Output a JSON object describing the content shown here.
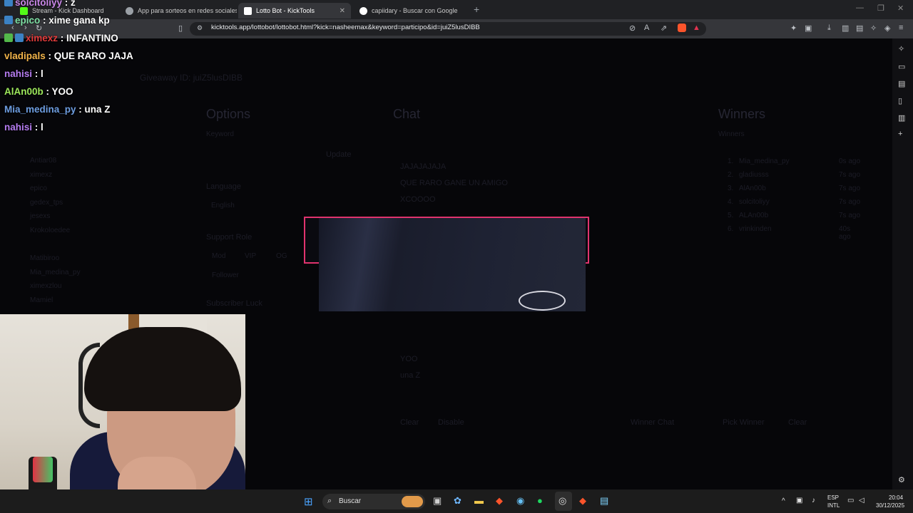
{
  "browser": {
    "tabs": [
      {
        "label": "Stream - Kick Dashboard"
      },
      {
        "label": "App para sorteos en redes sociales"
      },
      {
        "label": "Lotto Bot - KickTools"
      },
      {
        "label": "capiidary - Buscar con Google"
      }
    ],
    "url": "kicktools.app/lottobot/lottobot.html?kick=nasheemax&keyword=participo&id=juiZ5lusDIBB"
  },
  "chat_overlay": [
    {
      "user": "solcitoliyy",
      "message": "z",
      "color": "#c987e8"
    },
    {
      "user": "epico",
      "message": "xime gana kp",
      "color": "#7ee0a4"
    },
    {
      "user": "ximexz",
      "message": "INFANTINO",
      "color": "#e23b3b"
    },
    {
      "user": "vladipals",
      "message": "QUE RARO JAJA",
      "color": "#f2b44a"
    },
    {
      "user": "nahisi",
      "message": "l",
      "color": "#b57cf0"
    },
    {
      "user": "AlAn00b",
      "message": "YOO",
      "color": "#9de85b"
    },
    {
      "user": "Mia_medina_py",
      "message": "una Z",
      "color": "#6d9de0"
    },
    {
      "user": "nahisi",
      "message": "l",
      "color": "#b57cf0"
    }
  ],
  "page": {
    "giveaway_id": "Giveaway ID: juiZ5lusDIBB",
    "options": {
      "title": "Options",
      "keyword_label": "Keyword",
      "update_label": "Update",
      "language_label": "Language",
      "language_value": "English",
      "support_role_label": "Support Role",
      "roles": [
        "Mod",
        "VIP",
        "OG",
        "Follower"
      ],
      "subscriber_luck_label": "Subscriber Luck"
    },
    "chat": {
      "title": "Chat",
      "lines": [
        "JAJAJAJAJA",
        "QUE RARO GANE UN AMIGO",
        "XCOOOO",
        "YOO",
        "una Z"
      ],
      "buttons": [
        "Clear",
        "Disable",
        "Winner Chat"
      ]
    },
    "winners": {
      "title": "Winners",
      "subtitle": "Winners",
      "list": [
        {
          "rank": "1.",
          "name": "Mia_medina_py",
          "time": "0s ago"
        },
        {
          "rank": "2.",
          "name": "gladiusss",
          "time": "7s ago"
        },
        {
          "rank": "3.",
          "name": "AlAn00b",
          "time": "7s ago"
        },
        {
          "rank": "4.",
          "name": "solcitoliyy",
          "time": "7s ago"
        },
        {
          "rank": "5.",
          "name": "ALAn00b",
          "time": "7s ago"
        },
        {
          "rank": "6.",
          "name": "vrinkinden",
          "time": "40s ago"
        }
      ],
      "buttons": [
        "Pick Winner",
        "Clear"
      ]
    },
    "participants": [
      "Antiar08",
      "ximexz",
      "epico",
      "gedex_tps",
      "jesexs",
      "Krokoloedee",
      "",
      "Matibiroo",
      "Mia_medina_py",
      "ximexzlou",
      "Mamiel"
    ]
  },
  "taskbar": {
    "search_placeholder": "Buscar",
    "lang_top": "ESP",
    "lang_bottom": "INTL",
    "time": "20:04",
    "date": "30/12/2025"
  }
}
